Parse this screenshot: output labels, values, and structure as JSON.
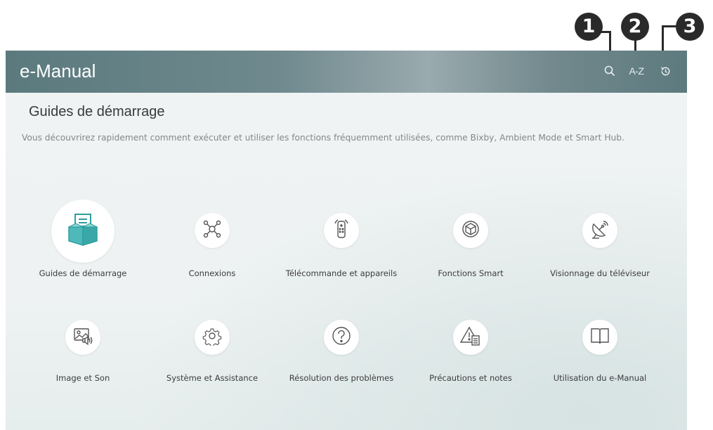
{
  "callouts": [
    "1",
    "2",
    "3"
  ],
  "header": {
    "title": "e-Manual",
    "az_label": "A-Z"
  },
  "section": {
    "title": "Guides de démarrage",
    "description": "Vous découvrirez rapidement comment exécuter et utiliser les fonctions fréquemment utilisées, comme Bixby, Ambient Mode et Smart Hub."
  },
  "tiles": [
    {
      "label": "Guides de démarrage",
      "icon": "box-document-icon",
      "selected": true
    },
    {
      "label": "Connexions",
      "icon": "network-icon"
    },
    {
      "label": "Télécommande et appareils",
      "icon": "remote-icon"
    },
    {
      "label": "Fonctions Smart",
      "icon": "cube-icon"
    },
    {
      "label": "Visionnage du téléviseur",
      "icon": "satellite-dish-icon"
    },
    {
      "label": "Image et Son",
      "icon": "picture-sound-icon"
    },
    {
      "label": "Système et Assistance",
      "icon": "gear-icon"
    },
    {
      "label": "Résolution des problèmes",
      "icon": "question-icon"
    },
    {
      "label": "Précautions et notes",
      "icon": "warning-note-icon"
    },
    {
      "label": "Utilisation du e-Manual",
      "icon": "book-icon"
    }
  ],
  "colors": {
    "header": "#6a868a",
    "accent_teal": "#3aa7a8",
    "callout": "#2a2a2a"
  }
}
